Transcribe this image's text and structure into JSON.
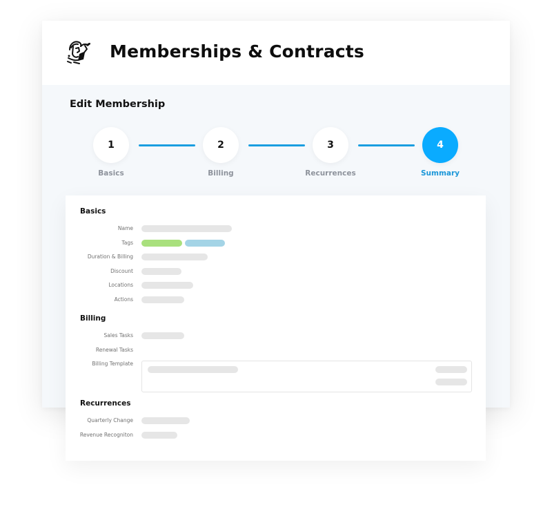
{
  "app": {
    "title": "Memberships & Contracts",
    "logo_icon": "spartan-helmet-logo"
  },
  "page": {
    "title": "Edit Membership"
  },
  "stepper": {
    "active_step": 4,
    "accent_color": "#0aabff",
    "steps": [
      {
        "number": "1",
        "label": "Basics"
      },
      {
        "number": "2",
        "label": "Billing"
      },
      {
        "number": "3",
        "label": "Recurrences"
      },
      {
        "number": "4",
        "label": "Summary"
      }
    ]
  },
  "summary": {
    "basics": {
      "title": "Basics",
      "fields": [
        {
          "label": "Name",
          "value": ""
        },
        {
          "label": "Tags",
          "tags": [
            {
              "color": "#a9e07d"
            },
            {
              "color": "#a4d4e6"
            }
          ]
        },
        {
          "label": "Duration & Billing",
          "value": ""
        },
        {
          "label": "Discount",
          "value": ""
        },
        {
          "label": "Locations",
          "value": ""
        },
        {
          "label": "Actions",
          "value": ""
        }
      ]
    },
    "billing": {
      "title": "Billing",
      "fields": [
        {
          "label": "Sales Tasks",
          "value": ""
        },
        {
          "label": "Renewal Tasks",
          "value": ""
        },
        {
          "label": "Billing Template",
          "value": ""
        }
      ]
    },
    "recurrences": {
      "title": "Recurrences",
      "fields": [
        {
          "label": "Quarterly Change",
          "value": ""
        },
        {
          "label": "Revenue Recogniton",
          "value": ""
        }
      ]
    }
  }
}
